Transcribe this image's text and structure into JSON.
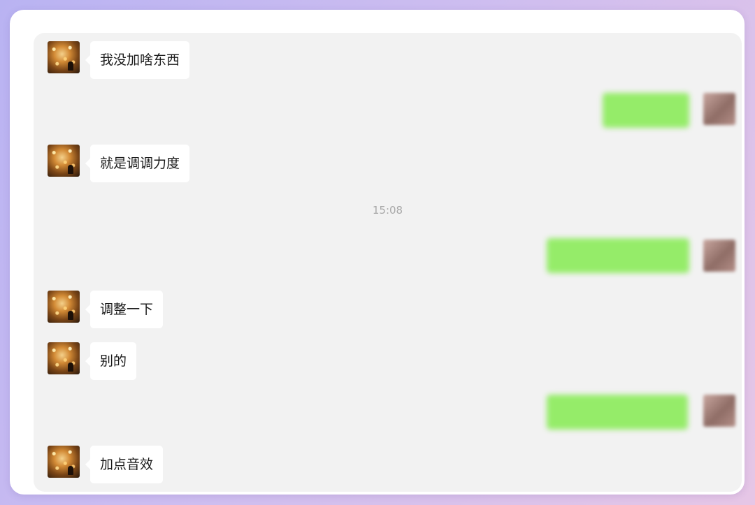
{
  "chat": {
    "timestamp": "15:08",
    "messages": [
      {
        "side": "received",
        "text": "我没加啥东西"
      },
      {
        "side": "sent",
        "text": ""
      },
      {
        "side": "received",
        "text": "就是调调力度"
      },
      {
        "side": "sent",
        "text": ""
      },
      {
        "side": "received",
        "text": "调整一下"
      },
      {
        "side": "received",
        "text": "别的"
      },
      {
        "side": "sent",
        "text": ""
      },
      {
        "side": "received",
        "text": "加点音效"
      }
    ]
  },
  "colors": {
    "background_start": "#b9b3f2",
    "background_end": "#e6c6e6",
    "chat_bg": "#f2f2f2",
    "received_bubble": "#ffffff",
    "sent_bubble": "#95ec69"
  }
}
